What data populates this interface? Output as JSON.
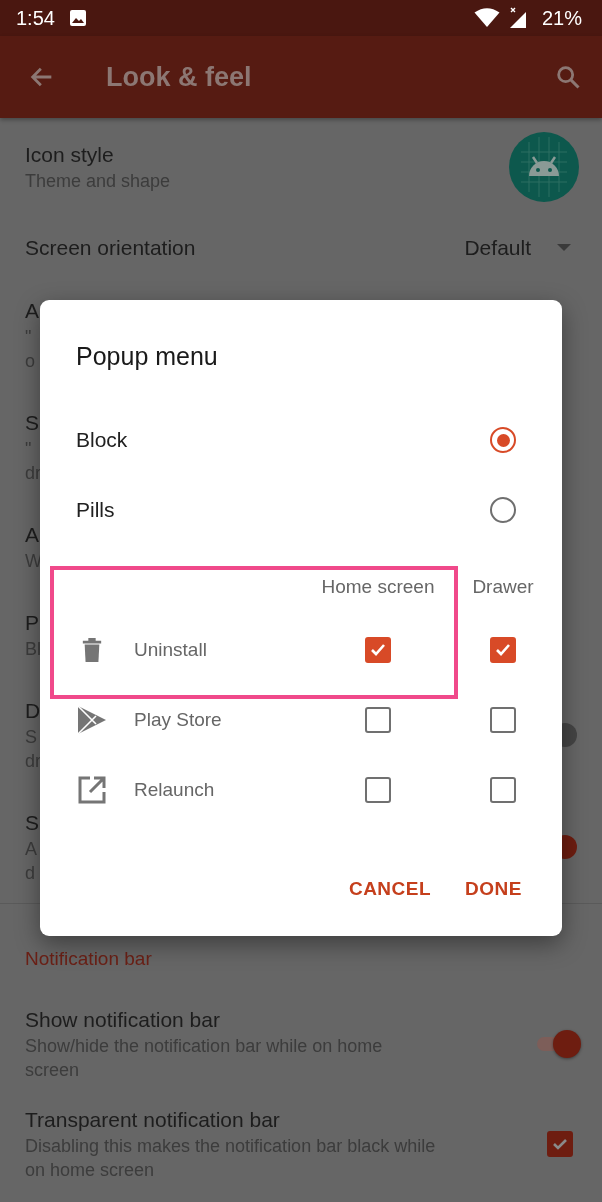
{
  "status_bar": {
    "time": "1:54",
    "battery": "21%"
  },
  "app_bar": {
    "title": "Look & feel"
  },
  "settings": [
    {
      "kind": "icon",
      "title": "Icon style",
      "subtitle": [
        "Theme and shape"
      ]
    },
    {
      "kind": "dropdown",
      "title": "Screen orientation",
      "value": "Default"
    },
    {
      "kind": "plain",
      "title": "A",
      "subtitle": [
        "\"",
        "o"
      ]
    },
    {
      "kind": "plain",
      "title": "S",
      "subtitle": [
        "\"",
        "dr"
      ]
    },
    {
      "kind": "plain",
      "title": "A",
      "subtitle": [
        "W"
      ]
    },
    {
      "kind": "plain",
      "title": "P",
      "subtitle": [
        "Bl"
      ]
    },
    {
      "kind": "switch",
      "title": "D",
      "subtitle": [
        "S",
        "dr"
      ],
      "on": false
    },
    {
      "kind": "switch",
      "title": "S",
      "subtitle": [
        "A",
        "d"
      ],
      "on": true
    }
  ],
  "section": {
    "title": "Notification bar"
  },
  "notification_settings": [
    {
      "kind": "switch",
      "title": "Show notification bar",
      "subtitle": [
        "Show/hide the notification bar while on home",
        "screen"
      ],
      "on": true
    },
    {
      "kind": "checkbox",
      "title": "Transparent notification bar",
      "subtitle": [
        "Disabling this makes the notification bar black while",
        "on home screen"
      ],
      "checked": true
    }
  ],
  "dialog": {
    "title": "Popup menu",
    "styles": [
      {
        "label": "Block",
        "selected": true
      },
      {
        "label": "Pills",
        "selected": false
      }
    ],
    "columns": [
      "Home screen",
      "Drawer"
    ],
    "actions": [
      {
        "kind": "trash",
        "label": "Uninstall",
        "home_screen": true,
        "drawer": true
      },
      {
        "kind": "store",
        "label": "Play Store",
        "home_screen": false,
        "drawer": false
      },
      {
        "kind": "launch",
        "label": "Relaunch",
        "home_screen": false,
        "drawer": false
      }
    ],
    "buttons": [
      "CANCEL",
      "DONE"
    ]
  }
}
